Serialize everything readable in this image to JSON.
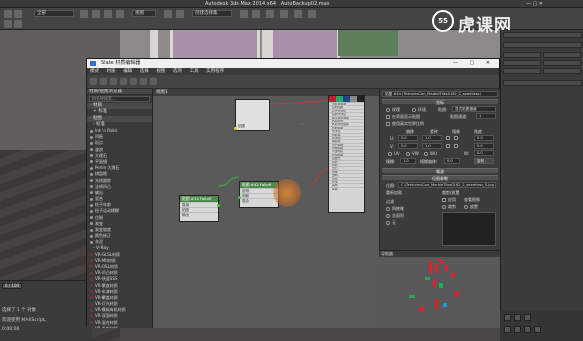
{
  "app": {
    "title": "Autodesk 3ds Max 2014 x64",
    "file": "AutoBackup02.max"
  },
  "watermark": {
    "badge": "55",
    "brand": "虎课网"
  },
  "slate": {
    "title": "Slate 材质编辑器",
    "menu": [
      "模式",
      "材质",
      "编辑",
      "选择",
      "视图",
      "选项",
      "工具",
      "实用程序"
    ],
    "view_tab": "视图1",
    "browser": {
      "header": "材质/贴图浏览器",
      "search_placeholder": "按名称搜索...",
      "sections": [
        {
          "label": "- 材质",
          "sub": [
            {
              "label": "+ 标准",
              "items": []
            }
          ]
        },
        {
          "label": "- 贴图",
          "sub": [
            {
              "label": "- 标准",
              "items": [
                "Ink 'n Paint",
                "凹痕",
                "斑点",
                "波浪",
                "大理石",
                "平面镜",
                "Perlin 大理石",
                "棋盘格",
                "光线跟踪",
                "法线凹凸",
                "输出",
                "混合",
                "粒子年龄",
                "粒子运动模糊",
                "位图",
                "渐变",
                "渐变坡度",
                "颜色修正",
                "灰泥"
              ]
            },
            {
              "label": "- V-Ray",
              "items": [
                "VR-GLSL材质",
                "VR-Mtl材质",
                "VR-OSL材质",
                "VR-凹凸材质",
                "VR-快速SSS",
                "VR-蒙皮材质",
                "VR-车漆材质",
                "VR-覆盖材质",
                "VR-灯光材质",
                "VR-模拟有机材质",
                "VR-双面材质",
                "VR-混合材质",
                "VR-毛发材质",
                "VR-矢量置换烘焙",
                "VR-雪花材质"
              ]
            }
          ]
        }
      ]
    },
    "nodes": {
      "bitmap_node": {
        "title": "贴图 #34",
        "sub": "Falloff",
        "rows": [
          "衰减",
          "贴图",
          "输出"
        ]
      },
      "falloff_node": {
        "title": "贴图 #42",
        "sub": "Falloff",
        "rows": [
          "前侧",
          "侧面",
          "混合"
        ]
      },
      "top_node": {
        "label": "贴图"
      },
      "material_rows": [
        "漫反射贴图",
        "反射贴图",
        "高光光泽度",
        "反射光泽度",
        "菲涅耳折射率",
        "各向异性",
        "各向异性旋转",
        "折射贴图",
        "光泽度",
        "折射率",
        "半透明",
        "雾颜色",
        "凹凸贴图",
        "置换贴图",
        "不透明度",
        "环境贴图",
        "自发光",
        "反射",
        "折射",
        "凹凸",
        "置换",
        "透明",
        "环境",
        "光泽",
        "其他",
        "蒙版"
      ]
    },
    "params": {
      "header": "贴图 #44 (TexturesCon_MarbleTiles0162_2_seamless)",
      "section_coords": "坐标",
      "tex_mode": "纹理",
      "env_mode": "环境",
      "mapping_label": "贴图:",
      "mapping_value": "显式贴图通道",
      "channel_label": "贴图通道:",
      "channel_value": "1",
      "show_on_back": "在背面显示贴图",
      "use_real_world": "使用真实世界比例",
      "offset_label": "偏移",
      "tiling_label": "瓷砖",
      "mirror_label": "镜像",
      "angle_label": "角度",
      "u_label": "U:",
      "v_label": "V:",
      "w_label": "W:",
      "u_offset": "0.0",
      "v_offset": "0.0",
      "u_tiling": "1.0",
      "v_tiling": "1.0",
      "u_angle": "0.0",
      "v_angle": "0.0",
      "w_angle": "0.0",
      "uv_label": "UV",
      "vw_label": "VW",
      "wu_label": "WU",
      "blur_label": "模糊:",
      "blur_value": "1.0",
      "blur_offset_label": "模糊偏移:",
      "blur_offset_value": "0.0",
      "rotate_button": "旋转",
      "noise_section": "噪波",
      "bitmap_section": "位图参数",
      "bitmap_label": "位图:",
      "bitmap_path": "C:\\Textures\\Con_MarbleTiles0162_2_seamless_S.jpg",
      "reload_button": "重新加载",
      "cropping_label": "裁剪/放置",
      "apply_label": "应用",
      "view_image_button": "查看图像",
      "crop_label": "裁剪",
      "place_label": "放置",
      "filter_label": "过滤",
      "pyramidal": "四棱锥",
      "summed_area": "总面积",
      "none": "无",
      "navigator_label": "导航器"
    }
  },
  "status": {
    "frame": "0 / 100",
    "selection": "选择了 1 个 对象",
    "welcome": "欢迎使用 MAXScript。",
    "x": "X:",
    "y": "Y:",
    "time": "0:00:00"
  }
}
